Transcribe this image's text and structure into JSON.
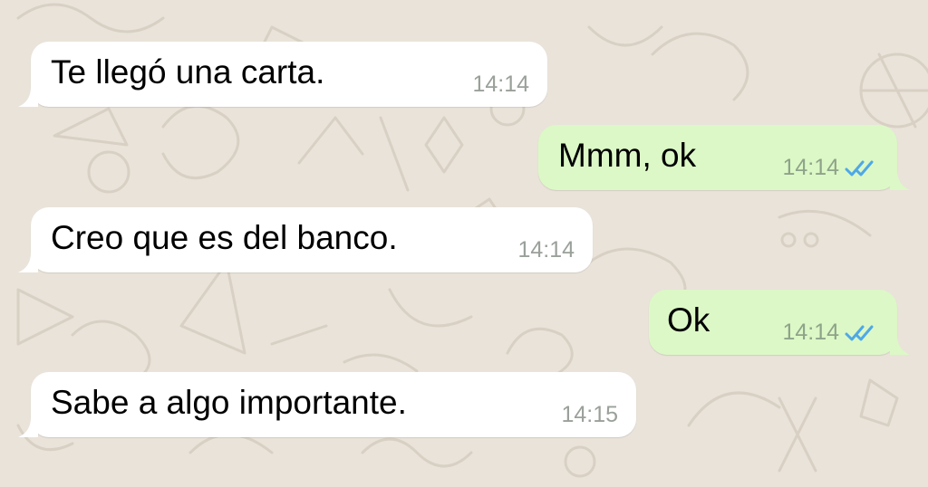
{
  "colors": {
    "wallpaper": "#e9e3da",
    "incoming_bubble": "#ffffff",
    "outgoing_bubble": "#dcf8c6",
    "read_ticks": "#4fa8e6",
    "timestamp": "#9aa09a"
  },
  "chat": {
    "messages": [
      {
        "direction": "incoming",
        "text": "Te llegó una carta.",
        "time": "14:14"
      },
      {
        "direction": "outgoing",
        "text": "Mmm, ok",
        "time": "14:14",
        "status_icon": "double-check-read-icon"
      },
      {
        "direction": "incoming",
        "text": "Creo que es del banco.",
        "time": "14:14"
      },
      {
        "direction": "outgoing",
        "text": "Ok",
        "time": "14:14",
        "status_icon": "double-check-read-icon"
      },
      {
        "direction": "incoming",
        "text": "Sabe a algo importante.",
        "time": "14:15"
      }
    ]
  }
}
